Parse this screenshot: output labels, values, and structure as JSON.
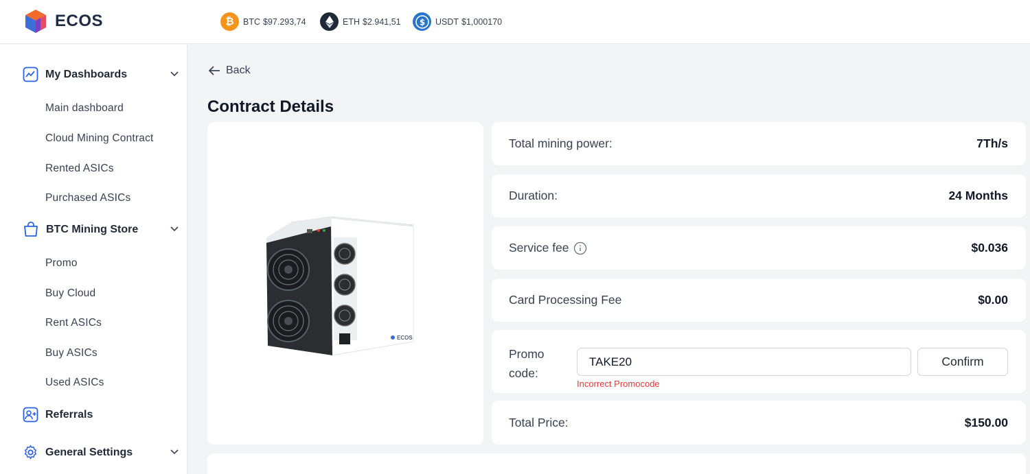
{
  "header": {
    "brand": "ECOS",
    "tickers": [
      {
        "symbol": "BTC",
        "price": "$97.293,74",
        "icon": "bitcoin-icon",
        "color": "#f7931a"
      },
      {
        "symbol": "ETH",
        "price": "$2.941,51",
        "icon": "ethereum-icon",
        "color": "#1f2937"
      },
      {
        "symbol": "USDT",
        "price": "$1,000170",
        "icon": "usdt-icon",
        "color": "#2775ca"
      }
    ]
  },
  "sidebar": {
    "dashboards": {
      "label": "My Dashboards",
      "items": [
        "Main dashboard",
        "Cloud Mining Contract",
        "Rented ASICs",
        "Purchased ASICs"
      ]
    },
    "store": {
      "label": "BTC Mining Store",
      "items": [
        "Promo",
        "Buy Cloud",
        "Rent ASICs",
        "Buy ASICs",
        "Used ASICs"
      ]
    },
    "referrals": {
      "label": "Referrals"
    },
    "settings": {
      "label": "General Settings"
    }
  },
  "main": {
    "back_label": "Back",
    "title": "Contract Details",
    "product_brand": "ECOS",
    "details": [
      {
        "key": "Total mining power:",
        "value": "7Th/s"
      },
      {
        "key": "Duration:",
        "value": "24 Months"
      },
      {
        "key": "Service fee",
        "value": "$0.036"
      },
      {
        "key": "Card Processing Fee",
        "value": "$0.00"
      }
    ],
    "promo": {
      "label_line1": "Promo",
      "label_line2": "code:",
      "value": "TAKE20",
      "error": "Incorrect Promocode",
      "confirm_label": "Confirm"
    },
    "total": {
      "key": "Total Price:",
      "value": "$150.00"
    }
  },
  "colors": {
    "accent": "#2563eb",
    "error": "#e53935",
    "btc": "#f7931a",
    "usdt": "#2775ca"
  }
}
